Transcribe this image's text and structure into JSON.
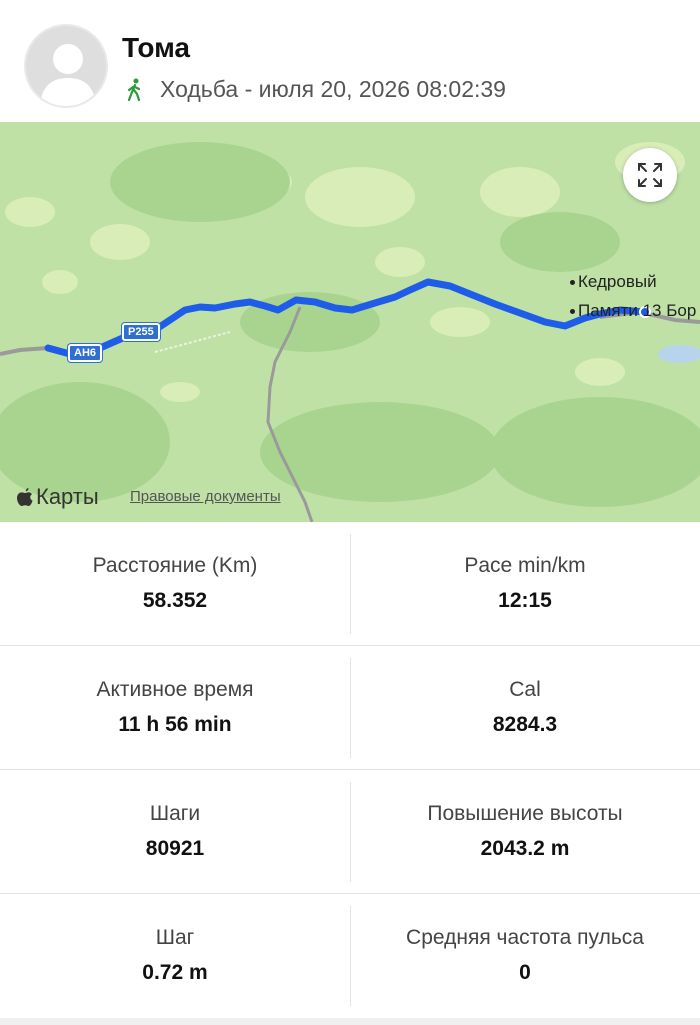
{
  "header": {
    "name": "Тома",
    "subline": "Ходьба - июля 20, 2026 08:02:39",
    "activity_icon": "walking-person-icon",
    "accent_color": "#2a9a3a"
  },
  "map": {
    "brand": "Карты",
    "legal": "Правовые документы",
    "places": [
      "Кедровый",
      "Памяти 13 Бор"
    ],
    "roads": [
      "AH6",
      "P255"
    ],
    "route_color": "#1f5de8",
    "expand_icon": "expand-arrows-icon"
  },
  "stats": [
    {
      "left": {
        "label": "Расстояние (Km)",
        "value": "58.352"
      },
      "right": {
        "label": "Pace min/km",
        "value": "12:15"
      }
    },
    {
      "left": {
        "label": "Активное время",
        "value": "11 h 56 min"
      },
      "right": {
        "label": "Cal",
        "value": "8284.3"
      }
    },
    {
      "left": {
        "label": "Шаги",
        "value": "80921"
      },
      "right": {
        "label": "Повышение высоты",
        "value": "2043.2 m"
      }
    },
    {
      "left": {
        "label": "Шаг",
        "value": "0.72 m"
      },
      "right": {
        "label": "Средняя частота пульса",
        "value": "0"
      }
    }
  ]
}
